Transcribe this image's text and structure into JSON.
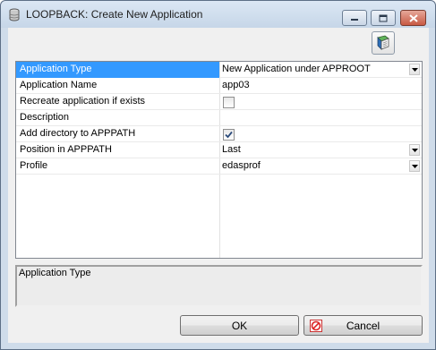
{
  "window": {
    "title": "LOOPBACK: Create New Application"
  },
  "properties": [
    {
      "label": "Application Type",
      "value": "New Application under APPROOT",
      "kind": "dropdown",
      "selected": true
    },
    {
      "label": "Application Name",
      "value": "app03",
      "kind": "text"
    },
    {
      "label": "Recreate application if exists",
      "value": "",
      "kind": "checkbox",
      "checked": false
    },
    {
      "label": "Description",
      "value": "",
      "kind": "text"
    },
    {
      "label": "Add directory to APPPATH",
      "value": "",
      "kind": "checkbox",
      "checked": true
    },
    {
      "label": "Position in APPPATH",
      "value": "Last",
      "kind": "dropdown"
    },
    {
      "label": "Profile",
      "value": "edasprof",
      "kind": "dropdown"
    }
  ],
  "description_panel": {
    "text": "Application Type"
  },
  "buttons": {
    "ok": "OK",
    "cancel": "Cancel"
  },
  "icons": {
    "title": "database-icon",
    "toolbar": "help-book-icon",
    "cancel": "cancel-icon"
  },
  "colors": {
    "selection": "#3399ff",
    "titlebar": "#c6d6e8",
    "close_button": "#c85a44"
  }
}
